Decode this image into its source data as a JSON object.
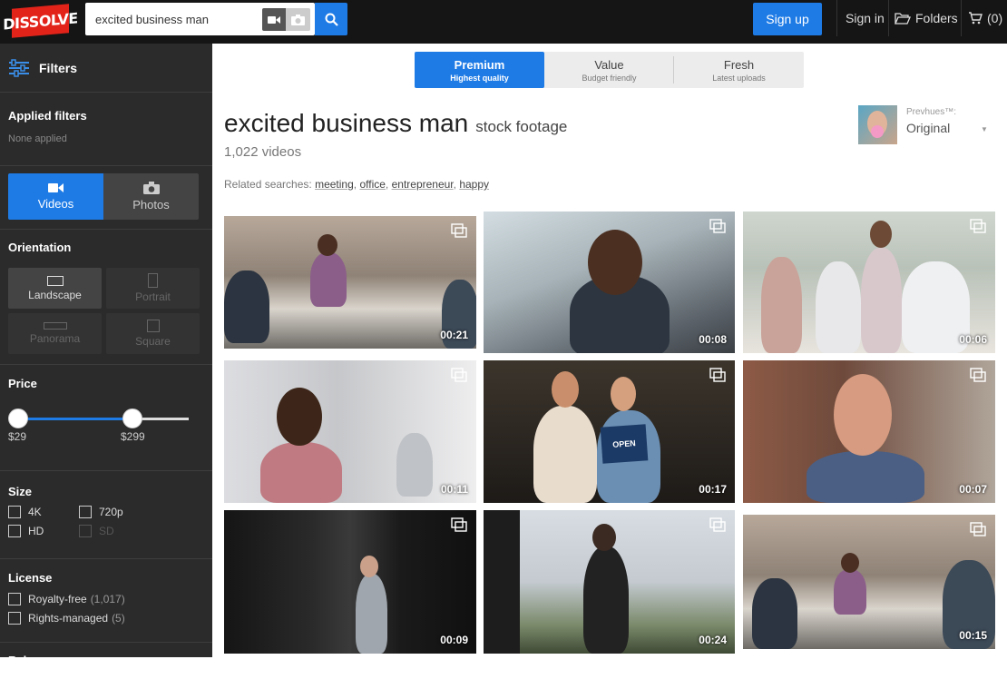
{
  "brand": {
    "logo_text": "DISSOLVE",
    "logo_color": "#e2231a"
  },
  "search": {
    "value": "excited business man"
  },
  "header": {
    "signup": "Sign up",
    "signin": "Sign in",
    "folders": "Folders",
    "cart": "(0)"
  },
  "sidebar": {
    "filters_title": "Filters",
    "applied_title": "Applied filters",
    "applied_value": "None applied",
    "media": {
      "videos": "Videos",
      "photos": "Photos"
    },
    "orientation": {
      "title": "Orientation",
      "landscape": "Landscape",
      "portrait": "Portrait",
      "panorama": "Panorama",
      "square": "Square"
    },
    "price": {
      "title": "Price",
      "min": "$29",
      "max": "$299",
      "selected_min_fraction": 0.0,
      "selected_max_fraction": 0.67
    },
    "size": {
      "title": "Size",
      "options": [
        "4K",
        "720p",
        "HD",
        "SD"
      ]
    },
    "license": {
      "title": "License",
      "royalty_free": "Royalty-free",
      "royalty_free_count": "(1,017)",
      "rights_managed": "Rights-managed",
      "rights_managed_count": "(5)"
    },
    "release": {
      "title": "Release"
    }
  },
  "quality_tabs": [
    {
      "label": "Premium",
      "sub": "Highest quality",
      "active": true
    },
    {
      "label": "Value",
      "sub": "Budget friendly",
      "active": false
    },
    {
      "label": "Fresh",
      "sub": "Latest uploads",
      "active": false
    }
  ],
  "results": {
    "query": "excited business man",
    "suffix": "stock footage",
    "count": "1,022 videos",
    "related_label": "Related searches:",
    "related": [
      "meeting",
      "office",
      "entrepreneur",
      "happy"
    ]
  },
  "prevhues": {
    "label": "Prevhues™:",
    "value": "Original"
  },
  "clips": [
    {
      "duration": "00:21"
    },
    {
      "duration": "00:08"
    },
    {
      "duration": "00:06"
    },
    {
      "duration": "00:11"
    },
    {
      "duration": "00:17"
    },
    {
      "duration": "00:07"
    },
    {
      "duration": "00:09"
    },
    {
      "duration": "00:24"
    },
    {
      "duration": "00:15"
    }
  ],
  "colors": {
    "accent": "#1e7be6",
    "topbar": "#151515",
    "sidebar": "#2b2b2b"
  }
}
